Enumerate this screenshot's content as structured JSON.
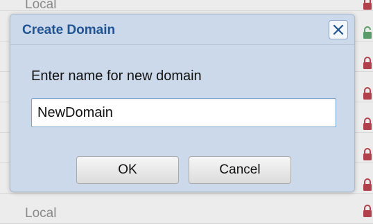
{
  "background": {
    "top_row_text": "Local",
    "bottom_row_text": "Local"
  },
  "dialog": {
    "title": "Create Domain",
    "prompt": "Enter name for new domain",
    "input_value": "NewDomain",
    "ok_label": "OK",
    "cancel_label": "Cancel",
    "close_icon": "close-icon"
  },
  "colors": {
    "dialog_bg": "#ccd9ea",
    "title": "#1f5392",
    "lock_locked": "#b1404a",
    "lock_unlocked": "#5a9b6a"
  }
}
